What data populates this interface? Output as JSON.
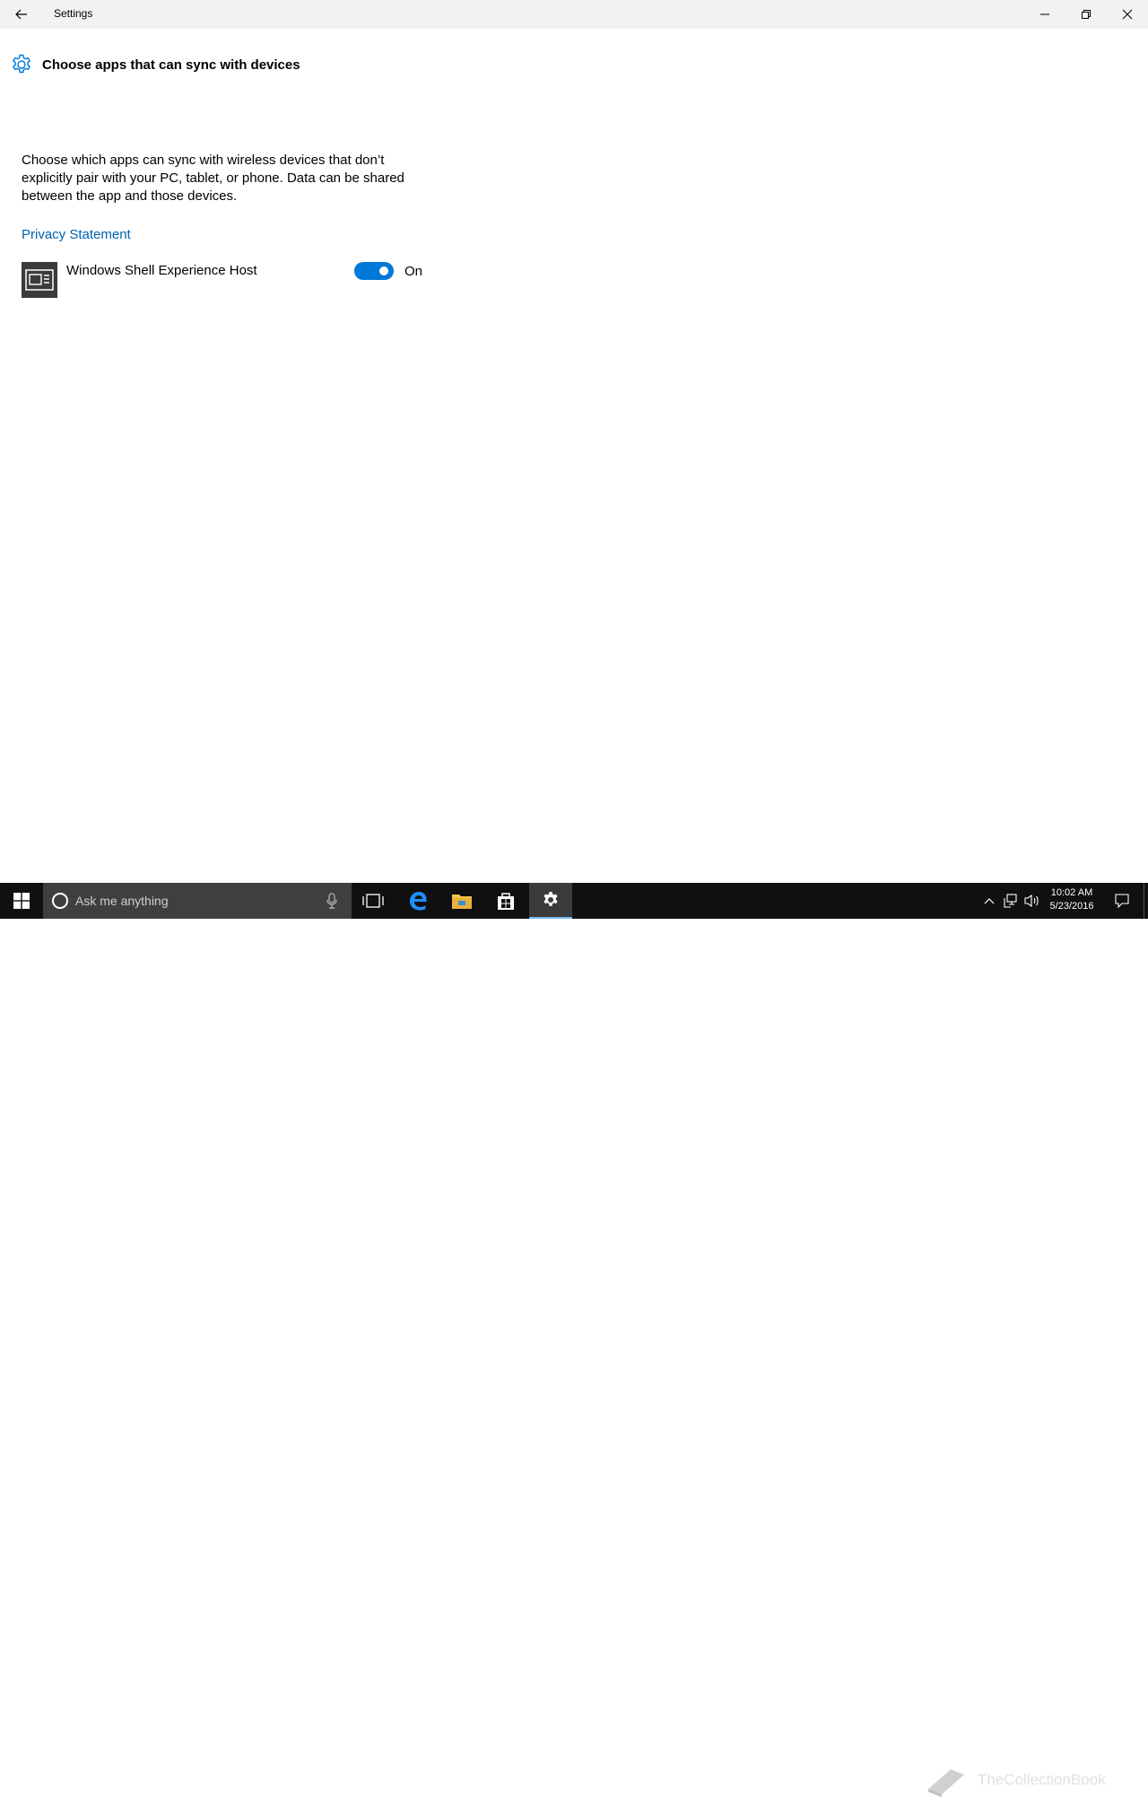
{
  "window": {
    "title": "Settings"
  },
  "page": {
    "heading": "Choose apps that can sync with devices",
    "description": "Choose which apps can sync with wireless devices that don’t explicitly pair with your PC, tablet, or phone. Data can be shared between the app and those devices.",
    "privacy_link": "Privacy Statement"
  },
  "apps": [
    {
      "name": "Windows Shell Experience Host",
      "toggle_on": true,
      "state_label": "On"
    }
  ],
  "taskbar": {
    "search_placeholder": "Ask me anything",
    "pinned": [
      "task-view-icon",
      "edge-icon",
      "file-explorer-icon",
      "store-icon",
      "settings-icon"
    ],
    "active": "settings-icon",
    "watermark": "TheCollectionBook",
    "clock_time": "10:02 AM",
    "clock_date": "5/23/2016"
  },
  "colors": {
    "accent": "#0078d7",
    "link": "#0063b1",
    "taskbar": "#101010",
    "titlebar": "#f2f2f2"
  }
}
